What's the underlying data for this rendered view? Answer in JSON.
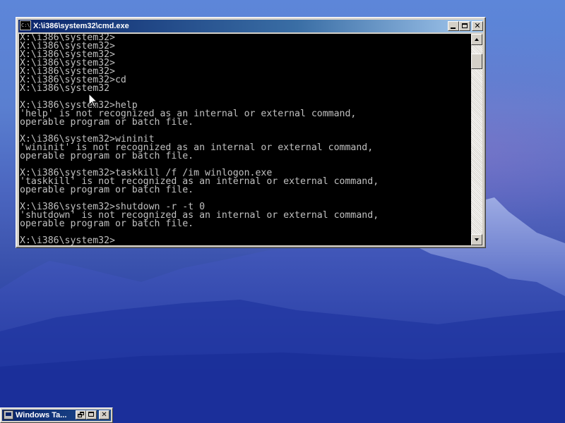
{
  "console": {
    "title": "X:\\i386\\system32\\cmd.exe",
    "icon_label": "C:\\",
    "lines": [
      "X:\\i386\\system32>",
      "X:\\i386\\system32>",
      "X:\\i386\\system32>",
      "X:\\i386\\system32>",
      "X:\\i386\\system32>",
      "X:\\i386\\system32>cd",
      "X:\\i386\\system32",
      "",
      "X:\\i386\\system32>help",
      "'help' is not recognized as an internal or external command,",
      "operable program or batch file.",
      "",
      "X:\\i386\\system32>wininit",
      "'wininit' is not recognized as an internal or external command,",
      "operable program or batch file.",
      "",
      "X:\\i386\\system32>taskkill /f /im winlogon.exe",
      "'taskkill' is not recognized as an internal or external command,",
      "operable program or batch file.",
      "",
      "X:\\i386\\system32>shutdown -r -t 0",
      "'shutdown' is not recognized as an internal or external command,",
      "operable program or batch file.",
      "",
      "X:\\i386\\system32>"
    ],
    "buttons": {
      "close_glyph": "✕"
    }
  },
  "minimized_window": {
    "title": "Windows Ta...",
    "close_glyph": "✕"
  },
  "icons": {
    "console_icon": "console-app-icon",
    "task_manager_icon": "task-manager-icon",
    "cursor": "mouse-pointer-icon"
  },
  "colors": {
    "titlebar_start": "#0a246a",
    "titlebar_end": "#a6caf0",
    "console_bg": "#000000",
    "console_text": "#c0c0c0",
    "chrome": "#d4d0c8"
  }
}
